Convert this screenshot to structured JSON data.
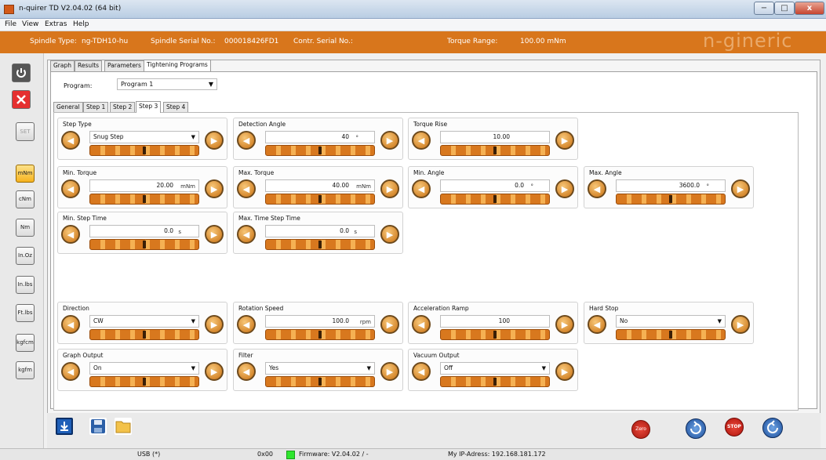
{
  "window": {
    "title": "n-quirer TD V2.04.02 (64 bit)",
    "min_glyph": "−",
    "max_glyph": "□",
    "close_glyph": "x"
  },
  "menu": [
    "File",
    "View",
    "Extras",
    "Help"
  ],
  "info": {
    "spindle_type_label": "Spindle Type:",
    "spindle_type": "ng-TDH10-hu",
    "serial_label": "Spindle Serial No.:",
    "serial": "000018426FD1",
    "contr_label": "Contr. Serial No.:",
    "torque_label": "Torque Range:",
    "torque": "100.00 mNm",
    "logo": "n-gineric",
    "accent": "#d8761c"
  },
  "sidebar": {
    "set_label": "SET",
    "units": [
      "mNm",
      "cNm",
      "Nm",
      "In.Oz",
      "In.lbs",
      "Ft.lbs",
      "kgfcm",
      "kgfm"
    ],
    "selected_unit": "mNm"
  },
  "main_tabs": [
    "Graph",
    "Results",
    "Parameters",
    "Tightening Programs"
  ],
  "program": {
    "label": "Program:",
    "value": "Program 1"
  },
  "step_tabs": [
    "General",
    "Step 1",
    "Step 2",
    "Step 3",
    "Step 4"
  ],
  "groups": {
    "step_type": {
      "label": "Step Type",
      "value": "Snug Step",
      "level": 0.5
    },
    "detection_angle": {
      "label": "Detection Angle",
      "value": "40",
      "unit": "°",
      "level": 0.5
    },
    "torque_rise": {
      "label": "Torque Rise",
      "value": "10.00",
      "level": 0.5
    },
    "min_torque": {
      "label": "Min. Torque",
      "value": "20.00",
      "unit": "mNm",
      "level": 0.5
    },
    "max_torque": {
      "label": "Max. Torque",
      "value": "40.00",
      "unit": "mNm",
      "level": 0.5
    },
    "min_angle": {
      "label": "Min. Angle",
      "value": "0.0",
      "unit": "°",
      "level": 0.5
    },
    "max_angle": {
      "label": "Max. Angle",
      "value": "3600.0",
      "unit": "°",
      "level": 0.5
    },
    "min_step_time": {
      "label": "Min. Step Time",
      "value": "0.0",
      "unit": "s",
      "level": 0.5
    },
    "max_time_step_time": {
      "label": "Max. Time Step Time",
      "value": "0.0",
      "unit": "s",
      "level": 0.5
    },
    "direction": {
      "label": "Direction",
      "value": "CW",
      "level": 0.5
    },
    "rotation_speed": {
      "label": "Rotation Speed",
      "value": "100.0",
      "unit": "rpm",
      "level": 0.5
    },
    "acceleration_ramp": {
      "label": "Acceleration Ramp",
      "value": "100",
      "level": 0.5
    },
    "hard_stop": {
      "label": "Hard Stop",
      "value": "No",
      "level": 0.5
    },
    "graph_output": {
      "label": "Graph Output",
      "value": "On",
      "level": 0.5
    },
    "filter": {
      "label": "Filter",
      "value": "Yes",
      "level": 0.5
    },
    "vacuum_output": {
      "label": "Vacuum Output",
      "value": "Off",
      "level": 0.5
    }
  },
  "bottom_buttons": {
    "zero": "Zero",
    "stop": "STOP"
  },
  "status": {
    "usb": "USB (*)",
    "code": "0x00",
    "firmware": "Firmware: V2.04.02 / -",
    "ip": "My IP-Adress: 192.168.181.172"
  }
}
